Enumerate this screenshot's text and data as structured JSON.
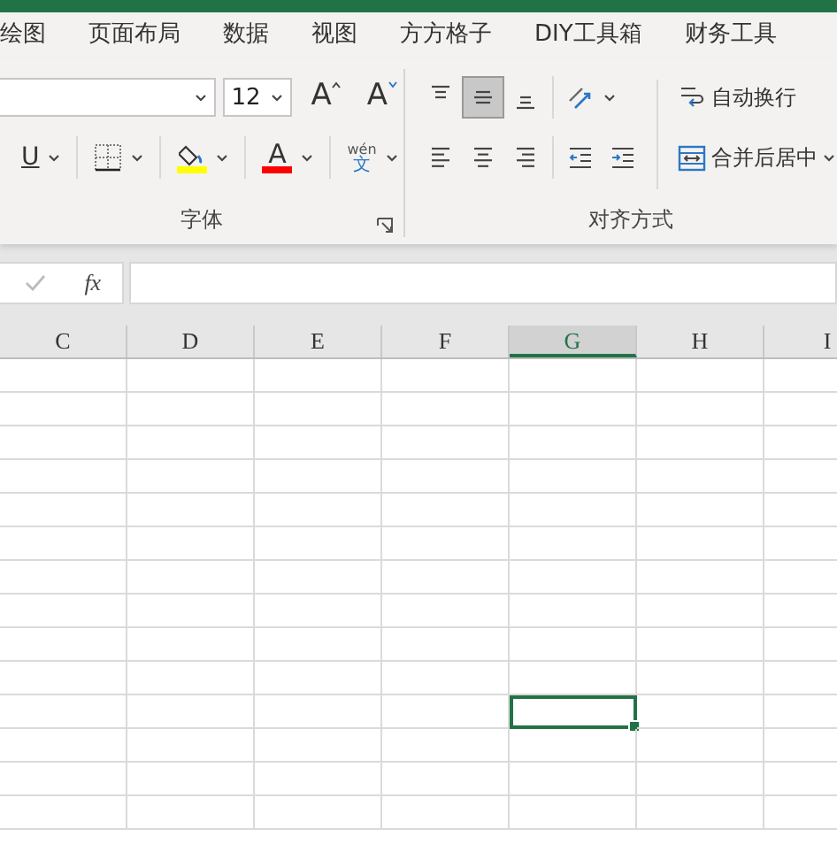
{
  "tabs": [
    {
      "label": "绘图",
      "selected": false
    },
    {
      "label": "页面布局",
      "selected": false
    },
    {
      "label": "数据",
      "selected": false
    },
    {
      "label": "视图",
      "selected": false
    },
    {
      "label": "方方格子",
      "selected": false
    },
    {
      "label": "DIY工具箱",
      "selected": false
    },
    {
      "label": "财务工具",
      "selected": false
    }
  ],
  "font_group": {
    "label": "字体",
    "font_size": "12",
    "size_buttons": [
      {
        "kind": "grow",
        "glyph": "A"
      },
      {
        "kind": "shrink",
        "glyph": "A"
      }
    ],
    "tools": [
      {
        "kind": "underline",
        "glyph": "U"
      },
      {
        "kind": "borders"
      },
      {
        "kind": "fill",
        "color": "#ffff00"
      },
      {
        "kind": "font-color",
        "glyph": "A",
        "color": "#ff0000"
      },
      {
        "kind": "phonetic",
        "glyph": "wén",
        "glyph_2": "文"
      }
    ]
  },
  "alignment_group": {
    "label": "对齐方式",
    "row_1": [
      {
        "kind": "top",
        "selected": false
      },
      {
        "kind": "middle",
        "selected": true
      },
      {
        "kind": "bottom",
        "selected": false
      },
      {
        "kind": "orientation",
        "selected": false
      }
    ],
    "row_2": [
      {
        "kind": "left",
        "selected": false
      },
      {
        "kind": "center",
        "selected": false
      },
      {
        "kind": "right",
        "selected": false
      },
      {
        "kind": "indent-decrease",
        "selected": false
      },
      {
        "kind": "indent-increase",
        "selected": false
      }
    ],
    "wrap_text": "自动换行",
    "merge_center": "合并后居中"
  },
  "formula_bar": {
    "fx": "fx"
  },
  "grid": {
    "columns": [
      {
        "label": "C",
        "selected": false
      },
      {
        "label": "D",
        "selected": false
      },
      {
        "label": "E",
        "selected": false
      },
      {
        "label": "F",
        "selected": false
      },
      {
        "label": "G",
        "selected": true
      },
      {
        "label": "H",
        "selected": false
      },
      {
        "label": "I",
        "selected": false
      }
    ],
    "rows": [
      {
        "cells": [
          {
            "selected": false
          },
          {
            "selected": false
          },
          {
            "selected": false
          },
          {
            "selected": false
          },
          {
            "selected": false
          },
          {
            "selected": false
          },
          {
            "selected": false
          }
        ]
      },
      {
        "cells": [
          {
            "selected": false
          },
          {
            "selected": false
          },
          {
            "selected": false
          },
          {
            "selected": false
          },
          {
            "selected": false
          },
          {
            "selected": false
          },
          {
            "selected": false
          }
        ]
      },
      {
        "cells": [
          {
            "selected": false
          },
          {
            "selected": false
          },
          {
            "selected": false
          },
          {
            "selected": false
          },
          {
            "selected": false
          },
          {
            "selected": false
          },
          {
            "selected": false
          }
        ]
      },
      {
        "cells": [
          {
            "selected": false
          },
          {
            "selected": false
          },
          {
            "selected": false
          },
          {
            "selected": false
          },
          {
            "selected": false
          },
          {
            "selected": false
          },
          {
            "selected": false
          }
        ]
      },
      {
        "cells": [
          {
            "selected": false
          },
          {
            "selected": false
          },
          {
            "selected": false
          },
          {
            "selected": false
          },
          {
            "selected": false
          },
          {
            "selected": false
          },
          {
            "selected": false
          }
        ]
      },
      {
        "cells": [
          {
            "selected": false
          },
          {
            "selected": false
          },
          {
            "selected": false
          },
          {
            "selected": false
          },
          {
            "selected": false
          },
          {
            "selected": false
          },
          {
            "selected": false
          }
        ]
      },
      {
        "cells": [
          {
            "selected": false
          },
          {
            "selected": false
          },
          {
            "selected": false
          },
          {
            "selected": false
          },
          {
            "selected": false
          },
          {
            "selected": false
          },
          {
            "selected": false
          }
        ]
      },
      {
        "cells": [
          {
            "selected": false
          },
          {
            "selected": false
          },
          {
            "selected": false
          },
          {
            "selected": false
          },
          {
            "selected": false
          },
          {
            "selected": false
          },
          {
            "selected": false
          }
        ]
      },
      {
        "cells": [
          {
            "selected": false
          },
          {
            "selected": false
          },
          {
            "selected": false
          },
          {
            "selected": false
          },
          {
            "selected": false
          },
          {
            "selected": false
          },
          {
            "selected": false
          }
        ]
      },
      {
        "cells": [
          {
            "selected": false
          },
          {
            "selected": false
          },
          {
            "selected": false
          },
          {
            "selected": false
          },
          {
            "selected": false
          },
          {
            "selected": false
          },
          {
            "selected": false
          }
        ]
      },
      {
        "cells": [
          {
            "selected": false
          },
          {
            "selected": false
          },
          {
            "selected": false
          },
          {
            "selected": false
          },
          {
            "selected": true
          },
          {
            "selected": false
          },
          {
            "selected": false
          }
        ]
      },
      {
        "cells": [
          {
            "selected": false
          },
          {
            "selected": false
          },
          {
            "selected": false
          },
          {
            "selected": false
          },
          {
            "selected": false
          },
          {
            "selected": false
          },
          {
            "selected": false
          }
        ]
      },
      {
        "cells": [
          {
            "selected": false
          },
          {
            "selected": false
          },
          {
            "selected": false
          },
          {
            "selected": false
          },
          {
            "selected": false
          },
          {
            "selected": false
          },
          {
            "selected": false
          }
        ]
      },
      {
        "cells": [
          {
            "selected": false
          },
          {
            "selected": false
          },
          {
            "selected": false
          },
          {
            "selected": false
          },
          {
            "selected": false
          },
          {
            "selected": false
          },
          {
            "selected": false
          }
        ]
      }
    ]
  }
}
